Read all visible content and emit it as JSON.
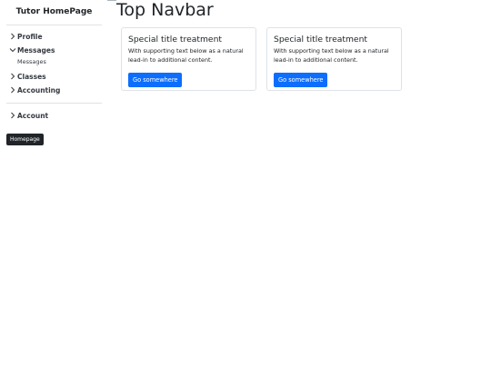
{
  "sidebar": {
    "brand": "Tutor HomePage",
    "items": [
      {
        "label": "Profile",
        "expanded": false
      },
      {
        "label": "Messages",
        "expanded": true,
        "children": [
          "Messages"
        ]
      },
      {
        "label": "Classes",
        "expanded": false
      },
      {
        "label": "Accounting",
        "expanded": false
      }
    ],
    "account_label": "Account",
    "home_button": "Homepage"
  },
  "main": {
    "title": "Top Navbar",
    "cards": [
      {
        "title": "Special title treatment",
        "text": "With supporting text below as a natural lead-in to additional content.",
        "button": "Go somewhere"
      },
      {
        "title": "Special title treatment",
        "text": "With supporting text below as a natural lead-in to additional content.",
        "button": "Go somewhere"
      }
    ]
  },
  "colors": {
    "primary": "#0d6efd",
    "dark": "#212529",
    "border": "#dee2e6"
  },
  "icons": {
    "collapsed": "chevron-right-icon",
    "expanded": "chevron-down-icon"
  }
}
